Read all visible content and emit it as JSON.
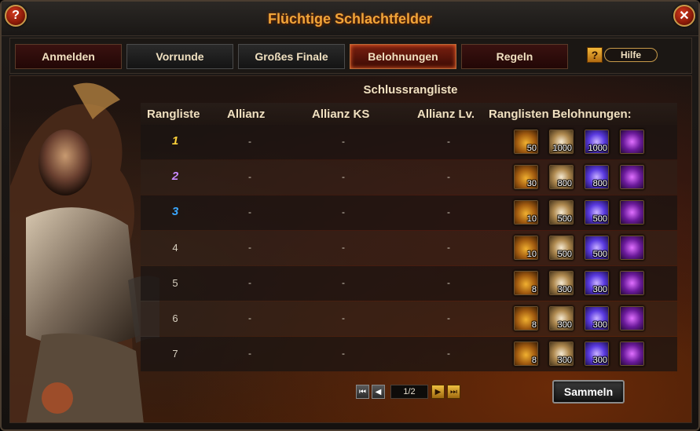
{
  "window": {
    "title": "Flüchtige Schlachtfelder"
  },
  "tabs": [
    {
      "label": "Anmelden"
    },
    {
      "label": "Vorrunde"
    },
    {
      "label": "Großes Finale"
    },
    {
      "label": "Belohnungen"
    },
    {
      "label": "Regeln"
    }
  ],
  "help": {
    "label": "Hilfe",
    "glyph": "?"
  },
  "corner_glyphs": {
    "help": "?",
    "close": "✕"
  },
  "section_title": "Schlussrangliste",
  "columns": {
    "rank": "Rangliste",
    "alliance": "Allianz",
    "alliance_ks": "Allianz KS",
    "alliance_lv": "Allianz Lv.",
    "rewards": "Ranglisten Belohnungen:"
  },
  "rows": [
    {
      "rank": "1",
      "alliance": "-",
      "ks": "-",
      "lv": "-",
      "rewards": [
        "50",
        "1000",
        "1000",
        ""
      ]
    },
    {
      "rank": "2",
      "alliance": "-",
      "ks": "-",
      "lv": "-",
      "rewards": [
        "30",
        "800",
        "800",
        ""
      ]
    },
    {
      "rank": "3",
      "alliance": "-",
      "ks": "-",
      "lv": "-",
      "rewards": [
        "10",
        "500",
        "500",
        ""
      ]
    },
    {
      "rank": "4",
      "alliance": "-",
      "ks": "-",
      "lv": "-",
      "rewards": [
        "10",
        "500",
        "500",
        ""
      ]
    },
    {
      "rank": "5",
      "alliance": "-",
      "ks": "-",
      "lv": "-",
      "rewards": [
        "8",
        "300",
        "300",
        ""
      ]
    },
    {
      "rank": "6",
      "alliance": "-",
      "ks": "-",
      "lv": "-",
      "rewards": [
        "8",
        "300",
        "300",
        ""
      ]
    },
    {
      "rank": "7",
      "alliance": "-",
      "ks": "-",
      "lv": "-",
      "rewards": [
        "8",
        "300",
        "300",
        ""
      ]
    }
  ],
  "reward_icons": [
    "gold-chest-icon",
    "orb-icon",
    "gem-icon",
    "mystery-box-icon"
  ],
  "pager": {
    "page": "1/2",
    "first": "⏮",
    "prev": "◀",
    "next": "▶",
    "last": "⏭"
  },
  "collect_label": "Sammeln",
  "colors": {
    "title": "#f0a53a",
    "rank1": "#ffd23a",
    "rank2": "#c88aff",
    "rank3": "#3aa8ff"
  }
}
